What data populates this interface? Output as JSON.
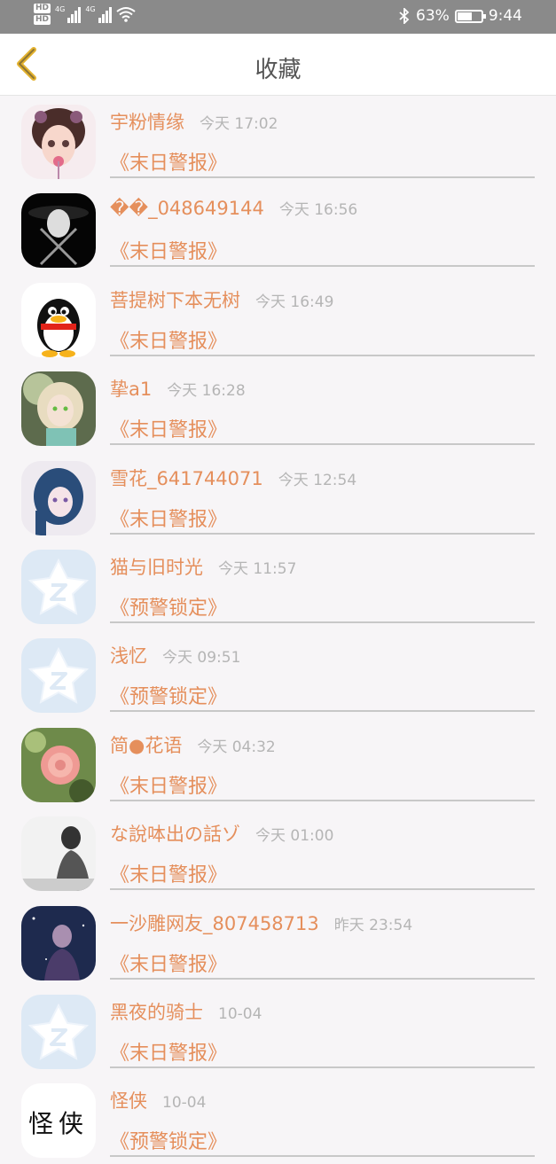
{
  "status_bar": {
    "network_labels": [
      "HD",
      "HD"
    ],
    "signal_labels": [
      "4G",
      "4G"
    ],
    "battery_percent": "63%",
    "battery_level": 0.63,
    "time": "9:44"
  },
  "header": {
    "back_icon": "chevron-left-icon",
    "title": "收藏"
  },
  "items": [
    {
      "name": "宇粉情缘",
      "time": "今天 17:02",
      "book": "《末日警报》",
      "avatar": "girl-avatar"
    },
    {
      "name": "��_048649144",
      "time": "今天 16:56",
      "book": "《末日警报》",
      "avatar": "mask-avatar"
    },
    {
      "name": "菩提树下本无树",
      "time": "今天 16:49",
      "book": "《末日警报》",
      "avatar": "qq-penguin-avatar"
    },
    {
      "name": "挚a1",
      "time": "今天 16:28",
      "book": "《末日警报》",
      "avatar": "fairy-avatar"
    },
    {
      "name": "雪花_641744071",
      "time": "今天 12:54",
      "book": "《末日警报》",
      "avatar": "blue-hair-avatar"
    },
    {
      "name": "猫与旧时光",
      "time": "今天 11:57",
      "book": "《预警锁定》",
      "avatar": "qzone-default-avatar"
    },
    {
      "name": "浅忆",
      "time": "今天 09:51",
      "book": "《预警锁定》",
      "avatar": "qzone-default-avatar"
    },
    {
      "name": "简●花语",
      "time": "今天 04:32",
      "book": "《末日警报》",
      "avatar": "rose-avatar"
    },
    {
      "name": "な說呠出の話ゾ",
      "time": "今天 01:00",
      "book": "《末日警报》",
      "avatar": "bw-photo-avatar"
    },
    {
      "name": "一沙雕网友_807458713",
      "time": "昨天 23:54",
      "book": "《末日警报》",
      "avatar": "night-boy-avatar"
    },
    {
      "name": "黑夜的骑士",
      "time": "10-04",
      "book": "《末日警报》",
      "avatar": "qzone-default-avatar"
    },
    {
      "name": "怪侠",
      "time": "10-04",
      "book": "《预警锁定》",
      "avatar": "calligraphy-avatar"
    }
  ],
  "calligraphy_text": "怪侠"
}
